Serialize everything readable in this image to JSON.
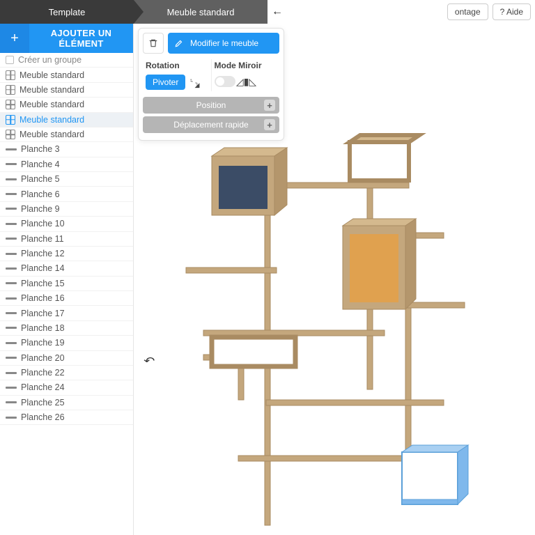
{
  "breadcrumb": {
    "root": "Template",
    "current": "Meuble standard"
  },
  "header": {
    "montage": "ontage",
    "help": "? Aide"
  },
  "sidebar": {
    "add_label": "AJOUTER UN ÉLÉMENT",
    "items": [
      {
        "label": "Créer un groupe",
        "icon": "group",
        "group": true
      },
      {
        "label": "Meuble standard",
        "icon": "cube"
      },
      {
        "label": "Meuble standard",
        "icon": "cube"
      },
      {
        "label": "Meuble standard",
        "icon": "cube"
      },
      {
        "label": "Meuble standard",
        "icon": "cube",
        "selected": true
      },
      {
        "label": "Meuble standard",
        "icon": "cube"
      },
      {
        "label": "Planche 3",
        "icon": "plank"
      },
      {
        "label": "Planche 4",
        "icon": "plank"
      },
      {
        "label": "Planche 5",
        "icon": "plank"
      },
      {
        "label": "Planche 6",
        "icon": "plank"
      },
      {
        "label": "Planche 9",
        "icon": "plank"
      },
      {
        "label": "Planche 10",
        "icon": "plank"
      },
      {
        "label": "Planche 11",
        "icon": "plank"
      },
      {
        "label": "Planche 12",
        "icon": "plank"
      },
      {
        "label": "Planche 14",
        "icon": "plank"
      },
      {
        "label": "Planche 15",
        "icon": "plank"
      },
      {
        "label": "Planche 16",
        "icon": "plank"
      },
      {
        "label": "Planche 17",
        "icon": "plank"
      },
      {
        "label": "Planche 18",
        "icon": "plank"
      },
      {
        "label": "Planche 19",
        "icon": "plank"
      },
      {
        "label": "Planche 20",
        "icon": "plank"
      },
      {
        "label": "Planche 22",
        "icon": "plank"
      },
      {
        "label": "Planche 24",
        "icon": "plank"
      },
      {
        "label": "Planche 25",
        "icon": "plank"
      },
      {
        "label": "Planche 26",
        "icon": "plank"
      }
    ]
  },
  "panel": {
    "modify": "Modifier le meuble",
    "rotation_label": "Rotation",
    "pivot": "Pivoter",
    "mirror_label": "Mode Miroir",
    "position": "Position",
    "quick_move": "Déplacement rapide"
  },
  "colors": {
    "wood": "#c4a77d",
    "wood_dark": "#a98b62",
    "navy": "#3b4c66",
    "orange": "#e0a14f",
    "blue_sel": "#7fb8ec",
    "blue_sel_side": "#5a9fd8"
  }
}
